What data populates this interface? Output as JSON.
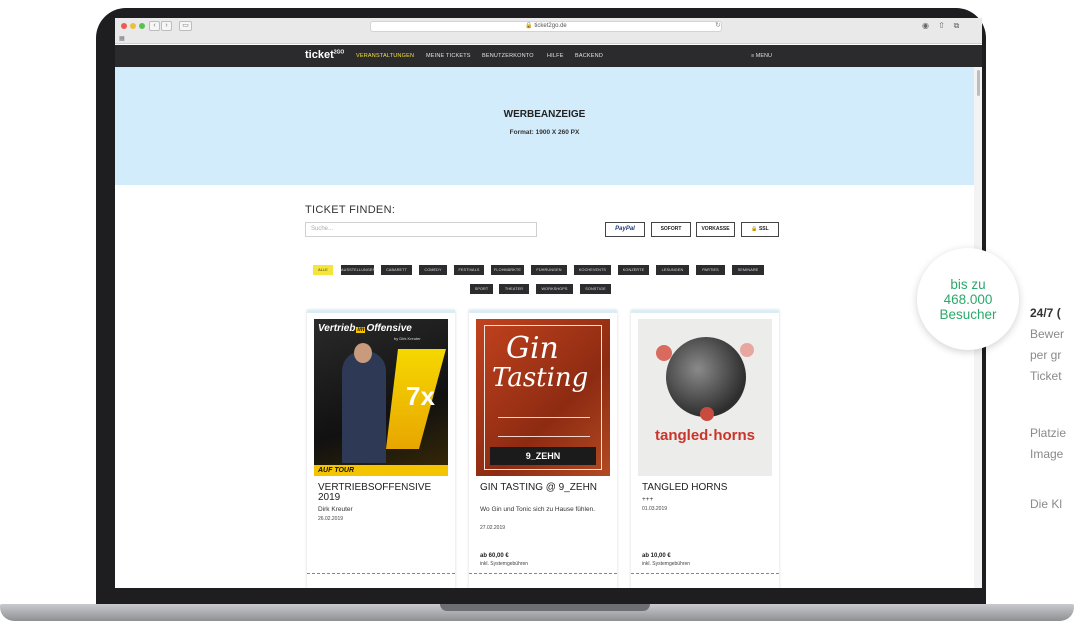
{
  "browser": {
    "url": "ticket2go.de"
  },
  "site": {
    "logo": "ticket",
    "logo_sup": "2GO",
    "nav": [
      "VERANSTALTUNGEN",
      "MEINE TICKETS",
      "BENUTZERKONTO",
      "HILFE",
      "BACKEND"
    ],
    "menu": "≡ MENU"
  },
  "ad": {
    "title": "WERBEANZEIGE",
    "subtitle": "Format: 1900 X 260 PX"
  },
  "finder": {
    "title": "TICKET FINDEN:",
    "search_placeholder": "Suche...",
    "payments": [
      "PayPal",
      "SOFORT",
      "VORKASSE",
      "🔒 SSL"
    ]
  },
  "categories": [
    "ALLE",
    "AUSSTELLUNGEN",
    "CABARETT",
    "COMEDY",
    "FESTIVALS",
    "FLOHMÄRKTE",
    "FÜHRUNGEN",
    "KOCHEVENTS",
    "KONZERTE",
    "LESUNGEN",
    "PARTIES",
    "SEMINARE",
    "SPORT",
    "THEATER",
    "WORKSHOPS",
    "SONSTIGE"
  ],
  "events": [
    {
      "title": "VERTRIEBSOFFENSIVE 2019",
      "subtitle": "Dirk Kreuter",
      "date": "26.02.2019",
      "price": "",
      "fee": ""
    },
    {
      "title": "GIN TASTING @ 9_ZEHN",
      "subtitle": "Wo Gin und Tonic sich zu Hause fühlen.",
      "date": "27.02.2019",
      "price": "ab 60,00 €",
      "fee": "inkl. Systemgebühren"
    },
    {
      "title": "TANGLED HORNS",
      "subtitle": "+++",
      "date": "01.03.2019",
      "price": "ab 10,00 €",
      "fee": "inkl. Systemgebühren"
    }
  ],
  "posters": {
    "p1_title": "Vertrieb",
    "p1_title2": "Offensive",
    "p1_by": "by Dirk Kreuter",
    "p1_big": "7x",
    "p1_tour": "AUF TOUR",
    "p2_title": "Gin",
    "p2_title2": "Tasting",
    "p2_venue": "9_ZEHN",
    "p3_title": "tangled·horns"
  },
  "badge": {
    "line1": "bis zu",
    "line2": "468.000",
    "line3": "Besucher"
  },
  "side": {
    "heading": "24/7 (",
    "lines": [
      "Bewer",
      "per gr",
      "Ticket",
      "Platzie",
      "Image",
      "Die Kl"
    ]
  }
}
